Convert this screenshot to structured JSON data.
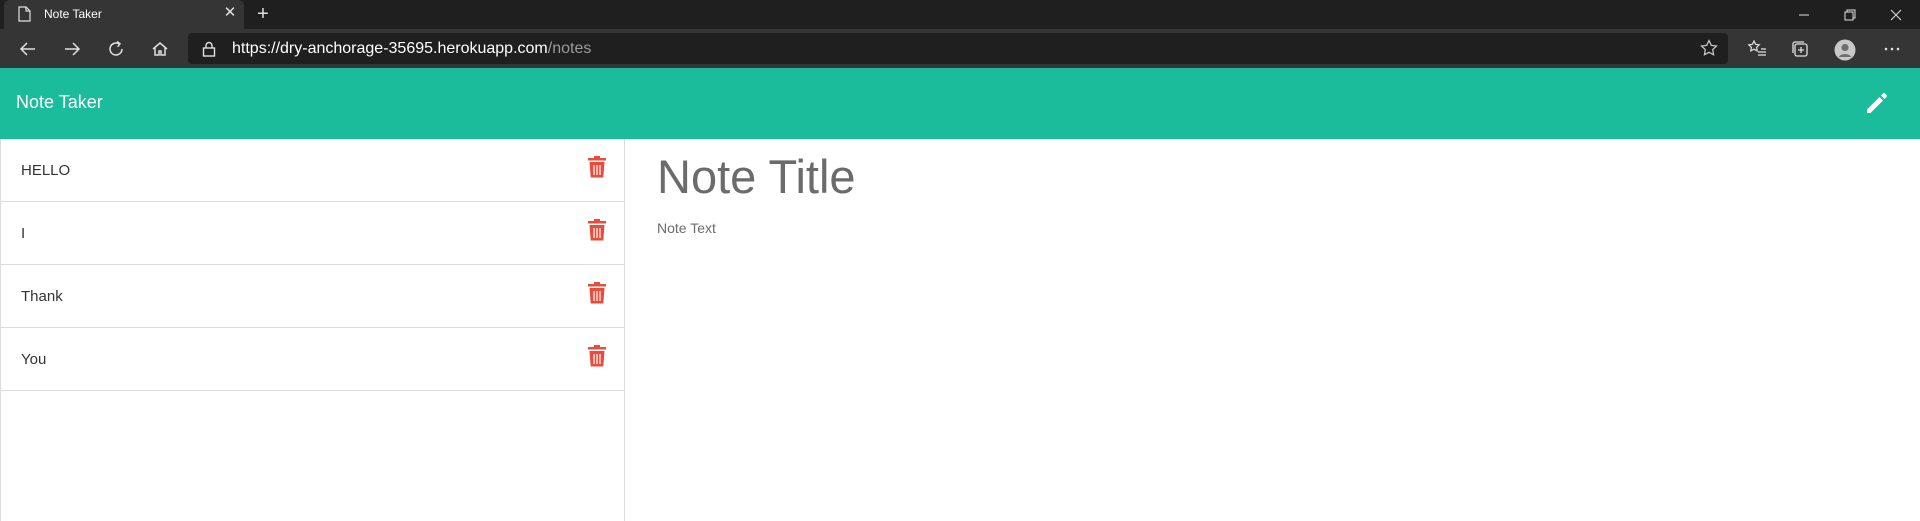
{
  "browser": {
    "tab_title": "Note Taker",
    "url_host": "https://dry-anchorage-35695.herokuapp.com",
    "url_path": "/notes"
  },
  "app": {
    "title": "Note Taker",
    "accent_color": "#1abc9c",
    "delete_color": "#e74c3c"
  },
  "notes": [
    {
      "title": "HELLO"
    },
    {
      "title": "I"
    },
    {
      "title": "Thank"
    },
    {
      "title": "You"
    }
  ],
  "editor": {
    "title_placeholder": "Note Title",
    "text_placeholder": "Note Text"
  }
}
